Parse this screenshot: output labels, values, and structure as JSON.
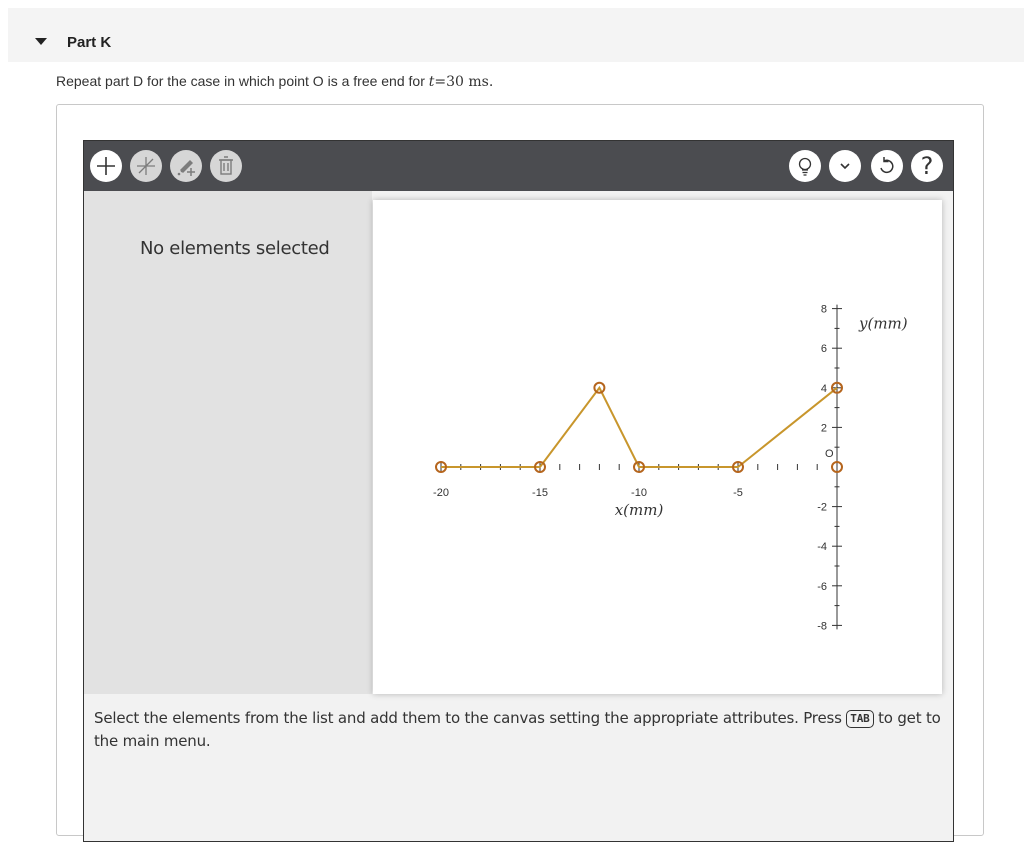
{
  "part": {
    "title": "Part K"
  },
  "question": {
    "text_before": "Repeat part D for the case in which point O is a free end for ",
    "var": "t",
    "text_after": "=30 ms."
  },
  "toolbar": {
    "left_buttons": [
      "add-icon",
      "line-icon",
      "add-point-icon",
      "delete-icon"
    ],
    "right_buttons": [
      "hint-icon",
      "chevron-down-icon",
      "reset-icon",
      "help-icon"
    ],
    "help_symbol": "?"
  },
  "side_panel": {
    "message": "No elements selected"
  },
  "instructions": {
    "before": "Select the elements from the list and add them to the canvas setting the appropriate attributes. Press ",
    "key": "TAB",
    "after": " to get to the main menu."
  },
  "chart_data": {
    "type": "line",
    "xlabel": "x(mm)",
    "ylabel": "y(mm)",
    "xlim": [
      -20,
      0
    ],
    "ylim": [
      -8,
      8
    ],
    "x_ticks": [
      -20,
      -15,
      -10,
      -5
    ],
    "y_ticks": [
      8,
      6,
      4,
      2,
      -2,
      -4,
      -6,
      -8
    ],
    "origin_label": "O",
    "series": [
      {
        "color": "#c8962c",
        "marker_color": "#b5651d",
        "points": [
          [
            -20,
            0
          ],
          [
            -15,
            0
          ],
          [
            -12,
            4
          ],
          [
            -10,
            0
          ],
          [
            -5,
            0
          ],
          [
            0,
            4
          ]
        ]
      }
    ],
    "extra_markers": [
      [
        0,
        0
      ]
    ]
  }
}
